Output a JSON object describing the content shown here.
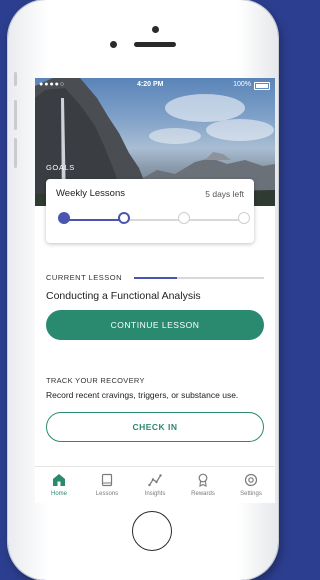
{
  "status_bar": {
    "signal": "●●●●○",
    "time": "4:20 PM",
    "battery": "100%"
  },
  "goals": {
    "section_label": "GOALS",
    "card_title": "Weekly Lessons",
    "days_left": "5 days left",
    "progress_total_steps": 4,
    "progress_completed_steps": 2
  },
  "current_lesson": {
    "section_label": "CURRENT LESSON",
    "progress_fraction": 0.33,
    "title": "Conducting a Functional Analysis",
    "button_label": "CONTINUE LESSON"
  },
  "recovery": {
    "section_label": "TRACK YOUR RECOVERY",
    "description": "Record recent cravings, triggers, or substance use.",
    "button_label": "CHECK IN"
  },
  "tabs": [
    {
      "label": "Home",
      "icon": "home-icon",
      "active": true
    },
    {
      "label": "Lessons",
      "icon": "book-icon",
      "active": false
    },
    {
      "label": "Insights",
      "icon": "chart-icon",
      "active": false
    },
    {
      "label": "Rewards",
      "icon": "award-icon",
      "active": false
    },
    {
      "label": "Settings",
      "icon": "gear-icon",
      "active": false
    }
  ],
  "colors": {
    "accent_green": "#2a8a70",
    "progress_blue": "#4a55b0",
    "background": "#2c3e8f"
  }
}
